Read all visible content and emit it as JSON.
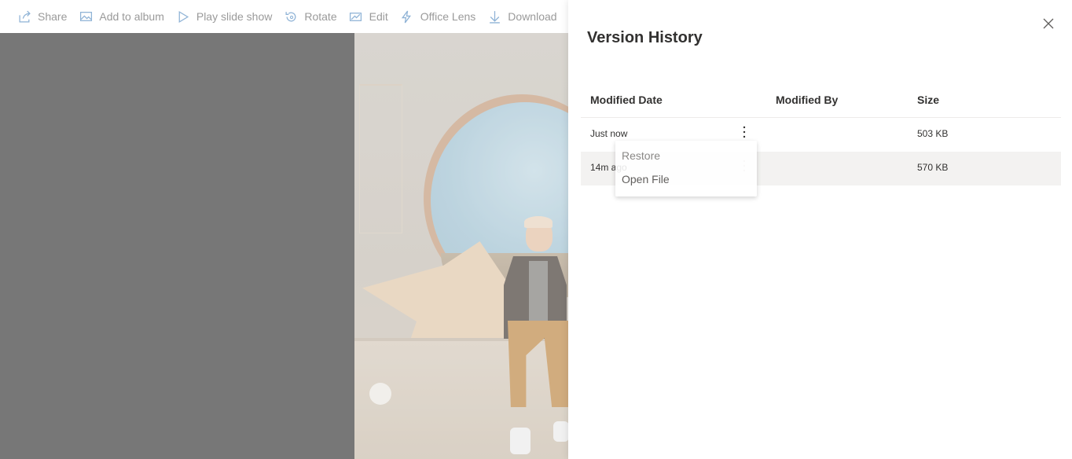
{
  "toolbar": {
    "items": [
      {
        "label": "Share",
        "icon": "share-icon"
      },
      {
        "label": "Add to album",
        "icon": "album-icon"
      },
      {
        "label": "Play slide show",
        "icon": "play-icon"
      },
      {
        "label": "Rotate",
        "icon": "rotate-icon"
      },
      {
        "label": "Edit",
        "icon": "edit-icon"
      },
      {
        "label": "Office Lens",
        "icon": "lightning-icon"
      },
      {
        "label": "Download",
        "icon": "download-icon"
      },
      {
        "label": "",
        "icon": "trash-icon"
      }
    ]
  },
  "panel": {
    "title": "Version History",
    "columns": {
      "date": "Modified Date",
      "by": "Modified By",
      "size": "Size"
    },
    "rows": [
      {
        "date": "Just now",
        "by": "",
        "size": "503 KB"
      },
      {
        "date": "14m ago",
        "by": "",
        "size": "570 KB"
      }
    ]
  },
  "context_menu": {
    "items": [
      "Restore",
      "Open File"
    ]
  },
  "colors": {
    "accent": "#0078d4",
    "toolbar_text": "#9a9a9a",
    "overlay": "#777777",
    "selected_row": "#f3f2f1"
  }
}
